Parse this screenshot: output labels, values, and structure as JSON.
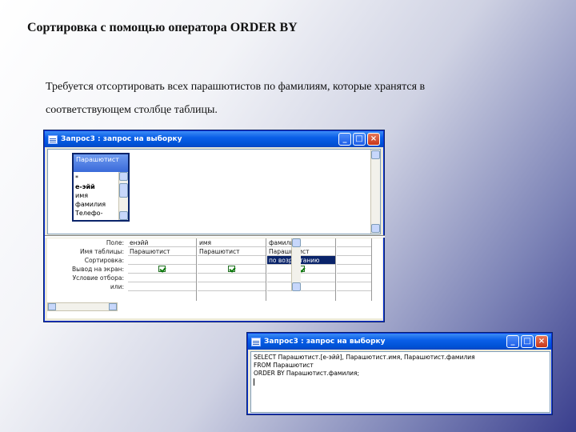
{
  "slide": {
    "title": "Сортировка с помощью оператора ORDER BY",
    "body_line1": "Требуется отсортировать всех парашютистов по фамилиям, которые хранятся в",
    "body_line2": "соответствующем столбце таблицы."
  },
  "designer_window": {
    "title": "Запрос3 : запрос на выборку",
    "table_name": "Парашютист",
    "fields": [
      "*",
      "е-эйй",
      "имя",
      "фамилия",
      "Телефо-"
    ],
    "row_labels": [
      "Поле:",
      "Имя таблицы:",
      "Сортировка:",
      "Вывод на экран:",
      "Условие отбора:",
      "или:"
    ],
    "columns": [
      {
        "field": "енэйй",
        "table": "Парашютист",
        "sort": "",
        "show": true
      },
      {
        "field": "имя",
        "table": "Парашютист",
        "sort": "",
        "show": true
      },
      {
        "field": "фамилия",
        "table": "Парашютист",
        "sort": "по возрастанию",
        "show": true
      }
    ]
  },
  "sql_window": {
    "title": "Запрос3 : запрос на выборку",
    "lines": [
      "SELECT Парашютист.[е-эйй], Парашютист.имя, Парашютист.фамилия",
      "FROM Парашютист",
      "ORDER BY Парашютист.фамилия;"
    ]
  },
  "icons": {
    "minimize": "minimize-icon",
    "maximize": "maximize-icon",
    "close": "close-icon"
  }
}
